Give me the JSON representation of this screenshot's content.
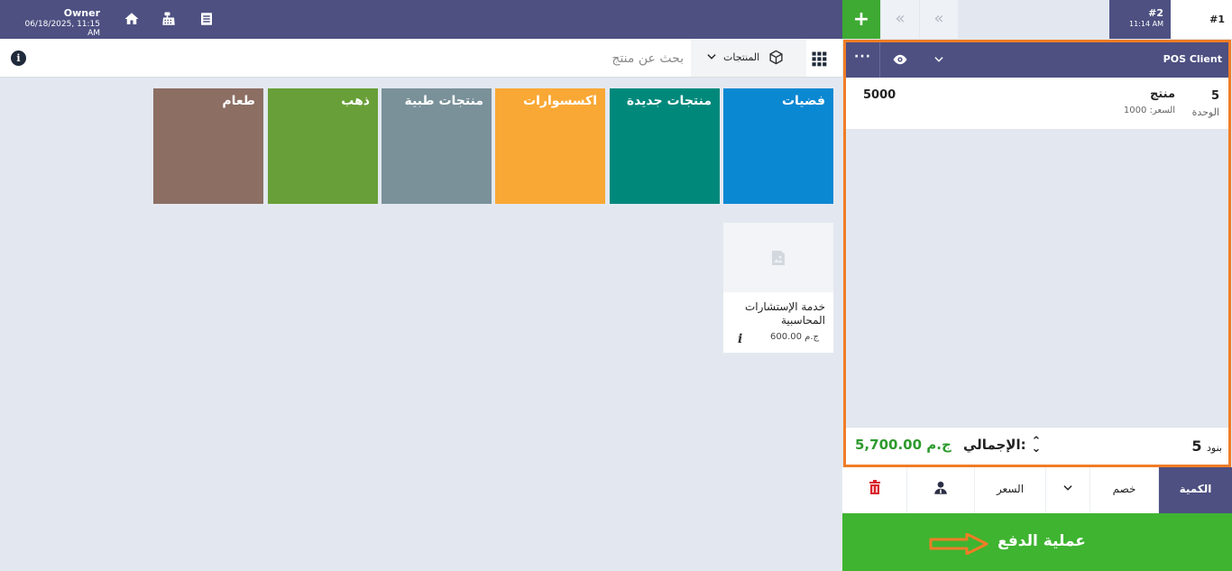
{
  "header": {
    "user_name": "Owner",
    "datetime": "06/18/2025, 11:15 AM",
    "icons": [
      "home-icon",
      "cash-register-icon",
      "receipt-icon"
    ]
  },
  "search": {
    "placeholder": "بحث عن منتج",
    "category_select": "المنتجات",
    "info_icon": "info-icon",
    "grid_icon": "grid-icon"
  },
  "categories": [
    {
      "label": "فضيات",
      "color": "#0b88d2"
    },
    {
      "label": "منتجات جديدة",
      "color": "#00897b"
    },
    {
      "label": "اكسسوارات",
      "color": "#f9a835"
    },
    {
      "label": "منتجات طبية",
      "color": "#7a9199"
    },
    {
      "label": "ذهب",
      "color": "#689f38"
    },
    {
      "label": "طعام",
      "color": "#8c6e63"
    }
  ],
  "products": [
    {
      "name": "خدمة الإستشارات المحاسبية",
      "price": "600.00 ج.م"
    }
  ],
  "orders": {
    "add_label": "+",
    "prev_label": "«",
    "next_label": "«",
    "tabs": [
      {
        "number": "#1"
      },
      {
        "number": "#2",
        "time": "11:14 AM"
      }
    ]
  },
  "order": {
    "client": "POS Client",
    "more_label": "···",
    "lines": [
      {
        "qty": "5",
        "unit": "الوحدة",
        "name": "منتج",
        "price": "السعر: 1000",
        "total": "5000"
      }
    ],
    "items_count": "5",
    "items_label": "بنود",
    "total_label": "الإجمالي:",
    "total_value": "5,700.00 ج.م"
  },
  "actions": {
    "quantity": "الكمية",
    "discount": "خصم",
    "price": "السعر"
  },
  "pay": {
    "label": "عملية الدفع"
  },
  "colors": {
    "header": "#4d5081",
    "accent_green": "#3fb431",
    "highlight_orange": "#f07c26",
    "total_green": "#2e9a2e"
  }
}
